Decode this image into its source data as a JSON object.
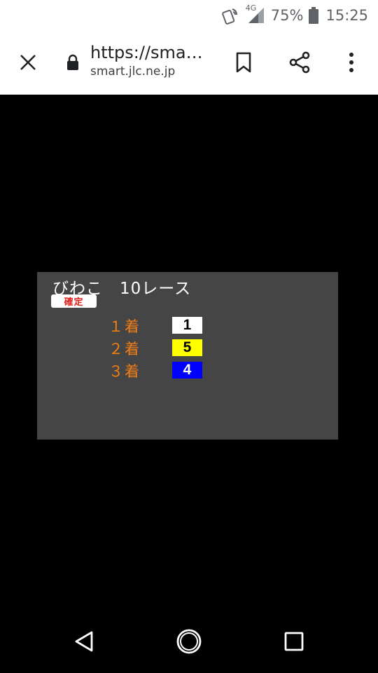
{
  "status_bar": {
    "network": "4G",
    "battery": "75%",
    "time": "15:25",
    "icons": [
      "nfc-tap-icon",
      "signal-icon",
      "battery-icon"
    ]
  },
  "browser": {
    "url_title": "https://sma…",
    "url_host": "smart.jlc.ne.jp",
    "icons": [
      "close-icon",
      "lock-icon",
      "bookmark-icon",
      "share-icon",
      "more-vert-icon"
    ]
  },
  "race": {
    "title": "びわこ　10レース",
    "status_badge": "確定",
    "results": [
      {
        "place": "１着",
        "boat": "1",
        "bg": "#ffffff",
        "fg": "#000000"
      },
      {
        "place": "２着",
        "boat": "5",
        "bg": "#ffff00",
        "fg": "#000000"
      },
      {
        "place": "３着",
        "boat": "4",
        "bg": "#0000ff",
        "fg": "#ffffff"
      }
    ]
  },
  "colors": {
    "panel_bg": "#454545",
    "place_text": "#f07f14",
    "badge_text": "#e0201a"
  },
  "nav": {
    "icons": [
      "back-triangle-icon",
      "home-circle-icon",
      "recents-square-icon"
    ]
  }
}
